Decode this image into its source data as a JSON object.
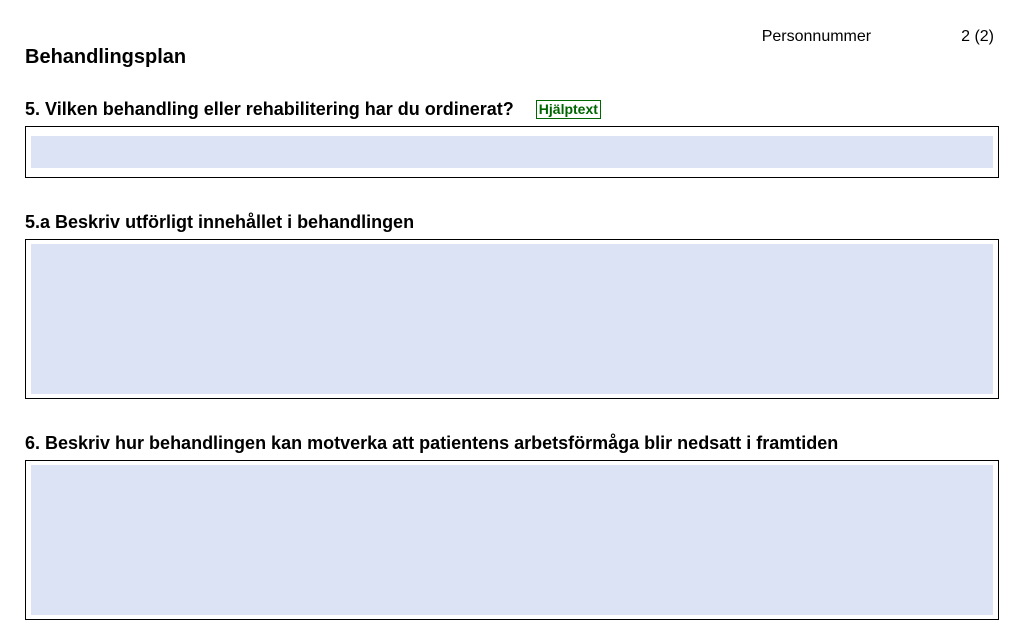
{
  "header": {
    "section_title": "Behandlingsplan",
    "top_label": "Personnummer",
    "page_number": "2 (2)"
  },
  "q5": {
    "label": "5. Vilken behandling eller rehabilitering har du ordinerat?",
    "help": "Hjälptext",
    "value": ""
  },
  "q5a": {
    "label": "5.a Beskriv utförligt innehållet i behandlingen",
    "value": ""
  },
  "q6": {
    "label": "6. Beskriv hur behandlingen kan motverka att patientens arbetsförmåga blir nedsatt i framtiden",
    "value": ""
  }
}
